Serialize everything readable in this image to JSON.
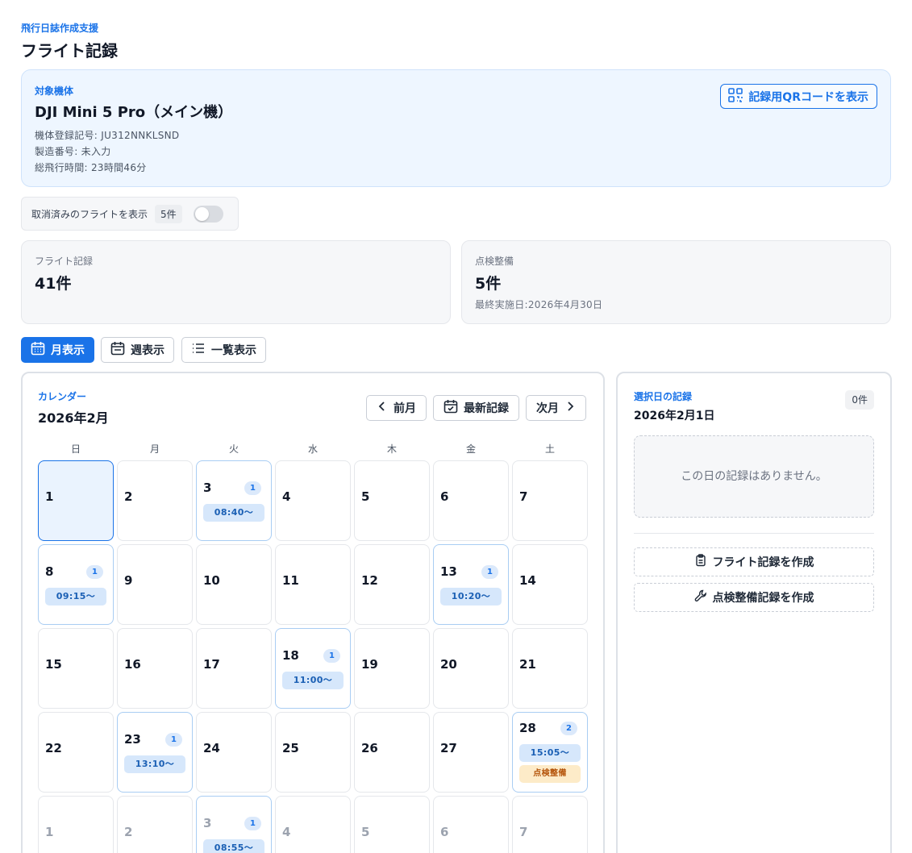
{
  "header": {
    "subtitle": "飛行日誌作成支援",
    "title": "フライト記録"
  },
  "aircraft": {
    "label": "対象機体",
    "name": "DJI Mini 5 Pro（メイン機）",
    "registration": "機体登録記号: JU312NNKLSND",
    "serial": "製造番号: 未入力",
    "total_time": "総飛行時間: 23時間46分",
    "qr_button": "記録用QRコードを表示"
  },
  "cancelled_toggle": {
    "label": "取消済みのフライトを表示",
    "count": "5件",
    "on": false
  },
  "stats": {
    "flight": {
      "label": "フライト記録",
      "value": "41件"
    },
    "maintenance": {
      "label": "点検整備",
      "value": "5件",
      "sub": "最終実施日:2026年4月30日"
    }
  },
  "view_tabs": [
    {
      "label": "月表示",
      "active": true
    },
    {
      "label": "週表示",
      "active": false
    },
    {
      "label": "一覧表示",
      "active": false
    }
  ],
  "calendar": {
    "label": "カレンダー",
    "month": "2026年2月",
    "prev": "前月",
    "latest": "最新記録",
    "next": "次月",
    "weekdays": [
      "日",
      "月",
      "火",
      "水",
      "木",
      "金",
      "土"
    ],
    "weeks": [
      [
        {
          "day": "1",
          "selected": true
        },
        {
          "day": "2"
        },
        {
          "day": "3",
          "count": "1",
          "chips": [
            "08:40〜"
          ]
        },
        {
          "day": "4"
        },
        {
          "day": "5"
        },
        {
          "day": "6"
        },
        {
          "day": "7"
        }
      ],
      [
        {
          "day": "8",
          "count": "1",
          "chips": [
            "09:15〜"
          ]
        },
        {
          "day": "9"
        },
        {
          "day": "10"
        },
        {
          "day": "11"
        },
        {
          "day": "12"
        },
        {
          "day": "13",
          "count": "1",
          "chips": [
            "10:20〜"
          ]
        },
        {
          "day": "14"
        }
      ],
      [
        {
          "day": "15"
        },
        {
          "day": "16"
        },
        {
          "day": "17"
        },
        {
          "day": "18",
          "count": "1",
          "chips": [
            "11:00〜"
          ]
        },
        {
          "day": "19"
        },
        {
          "day": "20"
        },
        {
          "day": "21"
        }
      ],
      [
        {
          "day": "22"
        },
        {
          "day": "23",
          "count": "1",
          "chips": [
            "13:10〜"
          ]
        },
        {
          "day": "24"
        },
        {
          "day": "25"
        },
        {
          "day": "26"
        },
        {
          "day": "27"
        },
        {
          "day": "28",
          "count": "2",
          "chips": [
            "15:05〜"
          ],
          "maint": "点検整備"
        }
      ],
      [
        {
          "day": "1",
          "other": true
        },
        {
          "day": "2",
          "other": true
        },
        {
          "day": "3",
          "other": true,
          "count": "1",
          "chips": [
            "08:55〜"
          ]
        },
        {
          "day": "4",
          "other": true
        },
        {
          "day": "5",
          "other": true
        },
        {
          "day": "6",
          "other": true
        },
        {
          "day": "7",
          "other": true
        }
      ]
    ]
  },
  "side": {
    "label": "選択日の記録",
    "date": "2026年2月1日",
    "count": "0件",
    "empty": "この日の記録はありません。",
    "create_flight": "フライト記録を作成",
    "create_maint": "点検整備記録を作成"
  },
  "colors": {
    "accent": "#1a73e8",
    "chip": "#d6e7fb",
    "maint_chip": "#fdebc8",
    "selected_day": "#eaf3fe"
  }
}
